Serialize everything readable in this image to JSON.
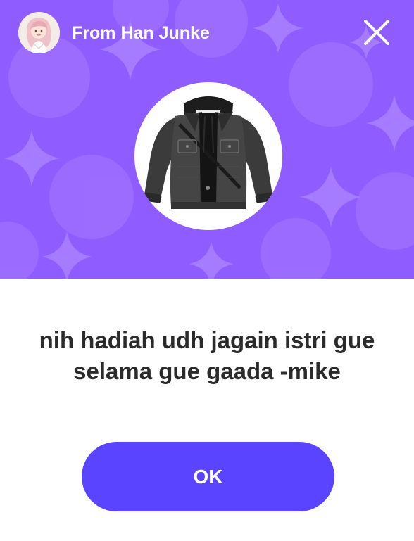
{
  "dialog": {
    "sender_label": "From Han Junke",
    "message": "nih hadiah udh jagain istri gue selama gue gaada -mike",
    "ok_label": "OK",
    "gift_icon": "denim-jacket-hoodie-icon",
    "avatar_icon": "user-avatar-icon",
    "close_icon": "close-icon"
  },
  "colors": {
    "header_bg": "#8f5cff",
    "pattern": "#9d70ff",
    "button_bg": "#5a44ff",
    "text_dark": "#2b2b2b"
  }
}
